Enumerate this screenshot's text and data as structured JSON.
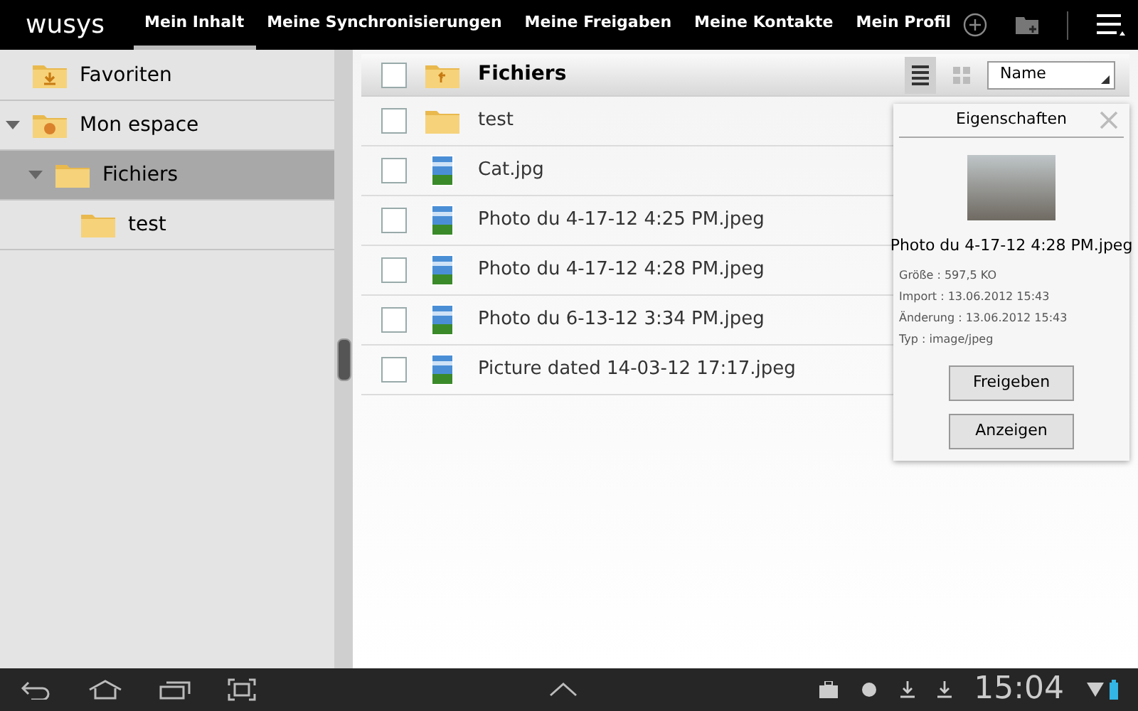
{
  "app_bar": {
    "logo": "wusys",
    "tabs": [
      {
        "label": "Mein Inhalt",
        "selected": true
      },
      {
        "label": "Meine Synchronisierungen",
        "selected": false
      },
      {
        "label": "Meine Freigaben",
        "selected": false
      },
      {
        "label": "Meine Kontakte",
        "selected": false
      },
      {
        "label": "Mein Profil",
        "selected": false
      }
    ]
  },
  "sidebar": {
    "items": [
      {
        "label": "Favoriten",
        "kind": "favorites",
        "selected": false
      },
      {
        "label": "Mon espace",
        "kind": "space",
        "selected": false,
        "expanded": true,
        "children": [
          {
            "label": "Fichiers",
            "kind": "folder",
            "selected": true,
            "expanded": true,
            "children": [
              {
                "label": "test",
                "kind": "folder",
                "selected": false
              }
            ]
          }
        ]
      }
    ]
  },
  "file_list": {
    "all_checked": false,
    "title": "Fichiers",
    "sort": "Name",
    "rows": [
      {
        "name": "test",
        "kind": "folder",
        "checked": false
      },
      {
        "name": "Cat.jpg",
        "kind": "image",
        "checked": false
      },
      {
        "name": "Photo du 4-17-12 4:25 PM.jpeg",
        "kind": "image",
        "checked": false
      },
      {
        "name": "Photo du 4-17-12 4:28 PM.jpeg",
        "kind": "image",
        "checked": false
      },
      {
        "name": "Photo du 6-13-12 3:34 PM.jpeg",
        "kind": "image",
        "checked": false
      },
      {
        "name": "Picture dated 14-03-12 17:17.jpeg",
        "kind": "image",
        "checked": false
      }
    ]
  },
  "properties": {
    "title": "Eigenschaften",
    "file_name": "Photo du 4-17-12 4:28 PM.jpeg",
    "details": [
      "Größe : 597,5 KO",
      "Import : 13.06.2012 15:43",
      "Änderung : 13.06.2012 15:43",
      "Typ : image/jpeg"
    ],
    "buttons": [
      "Freigeben",
      "Anzeigen"
    ]
  },
  "status_bar": {
    "time": "15:04"
  }
}
